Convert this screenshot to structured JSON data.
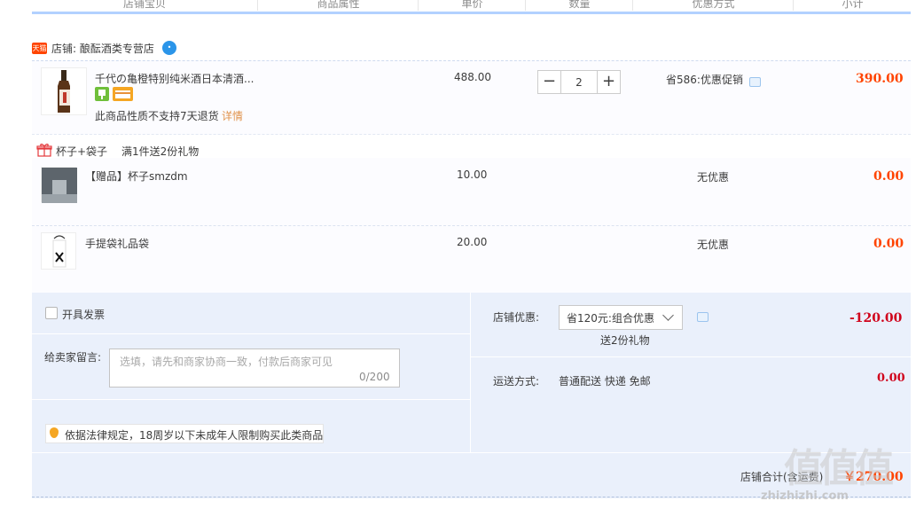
{
  "header": {
    "columns": [
      "店铺宝贝",
      "商品属性",
      "单价",
      "数量",
      "优惠方式",
      "小计"
    ]
  },
  "shop": {
    "badge": "天猫",
    "name": "店铺: 酿酝酒类专营店"
  },
  "item": {
    "title": "千代の亀橙特别纯米酒日本清酒...",
    "notice": "此商品性质不支持7天退货",
    "notice_link": "详情",
    "unit_price": "488.00",
    "quantity": "2",
    "promo": "省586:优惠促销",
    "subtotal": "390.00"
  },
  "gift_group": {
    "title": "杯子+袋子",
    "rule": "满1件送2份礼物",
    "items": [
      {
        "title": "【赠品】杯子smzdm",
        "unit_price": "10.00",
        "promo": "无优惠",
        "subtotal": "0.00"
      },
      {
        "title": "手提袋礼品袋",
        "unit_price": "20.00",
        "promo": "无优惠",
        "subtotal": "0.00"
      }
    ]
  },
  "order_footer": {
    "invoice_label": "开具发票",
    "message_label": "给卖家留言:",
    "message_placeholder": "选填，请先和商家协商一致，付款后商家可见",
    "message_count": "0/200",
    "legal_notice": "依据法律规定，18周岁以下未成年人限制购买此类商品",
    "shop_discount_label": "店铺优惠:",
    "shop_discount_selected": "省120元:组合优惠",
    "gift_note": "送2份礼物",
    "shop_discount_amount": "-120.00",
    "shipping_label": "运送方式:",
    "shipping_value": "普通配送 快递 免邮",
    "shipping_amount": "0.00",
    "total_label": "店铺合计(含运费)",
    "total_amount": "￥270.00"
  },
  "watermark": {
    "text": "值值值",
    "url": "zhizhizhi.com"
  },
  "colors": {
    "price": "#ff4400",
    "discount": "#d0021b",
    "accent_border": "#b2d1ff",
    "panel_bg": "#eaf0fb"
  }
}
